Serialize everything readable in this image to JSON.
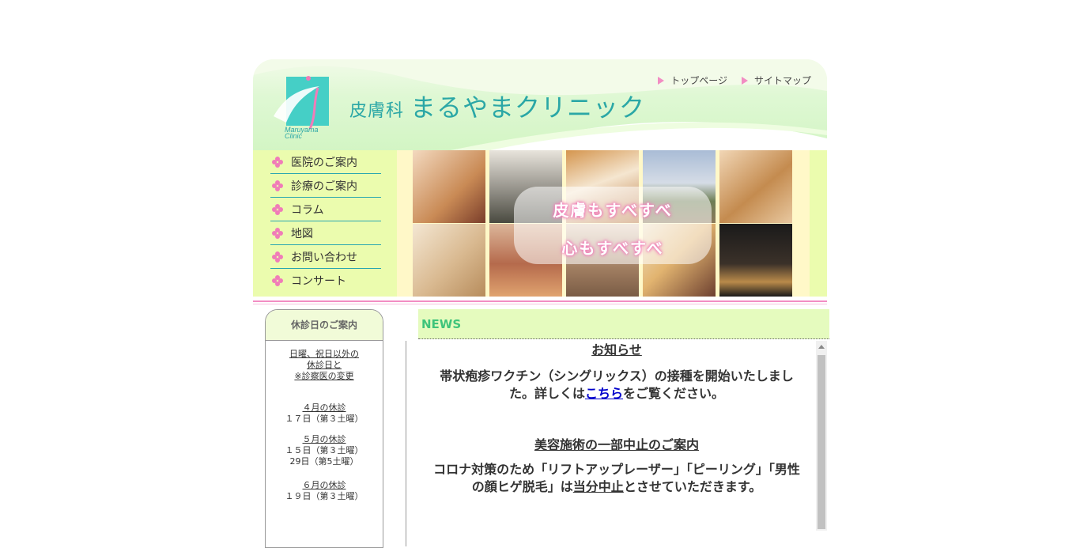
{
  "header": {
    "clinic_name_small": "皮膚科",
    "clinic_name_main": "まるやまクリニック",
    "logo_text_1": "Maruyama",
    "logo_text_2": "Clinic",
    "top_links": [
      "トップページ",
      "サイトマップ"
    ]
  },
  "nav": {
    "items": [
      "医院のご案内",
      "診療のご案内",
      "コラム",
      "地図",
      "お問い合わせ",
      "コンサート"
    ]
  },
  "slogan": {
    "line1": "皮膚もすべすべ",
    "line2": "心もすべすべ"
  },
  "holiday": {
    "title": "休診日のご案内",
    "notice_1": "日曜、祝日以外の",
    "notice_2": "休診日と",
    "notice_3": "※診察医の変更",
    "months": [
      {
        "label": "４月の休診",
        "days": [
          "１７日（第３土曜）"
        ]
      },
      {
        "label": "５月の休診",
        "days": [
          "１５日（第３土曜）",
          "29日（第5土曜）"
        ]
      },
      {
        "label": "６月の休診",
        "days": [
          "１９日（第３土曜）"
        ]
      }
    ]
  },
  "news": {
    "title": "NEWS",
    "heading1": "お知らせ",
    "body1_a": "帯状疱疹ワクチン（シングリックス）の接種を開始いたしました。詳しくは",
    "body1_link": "こちら",
    "body1_b": "をご覧ください。",
    "heading2": "美容施術の一部中止のご案内",
    "body2_a": "コロナ対策のため「リフトアップレーザー」「ピーリング」「男性の顔ヒゲ脱毛」は",
    "body2_u": "当分中止",
    "body2_b": "とさせていただきます。"
  },
  "colors": {
    "accent_pink": "#f28dc3",
    "teal": "#2aa7a6",
    "nav_bg": "#ebfcae",
    "news_green": "#3fc47b"
  },
  "icons": [
    "flower-bullet-icon",
    "triangle-arrow-icon",
    "scroll-up-icon"
  ]
}
